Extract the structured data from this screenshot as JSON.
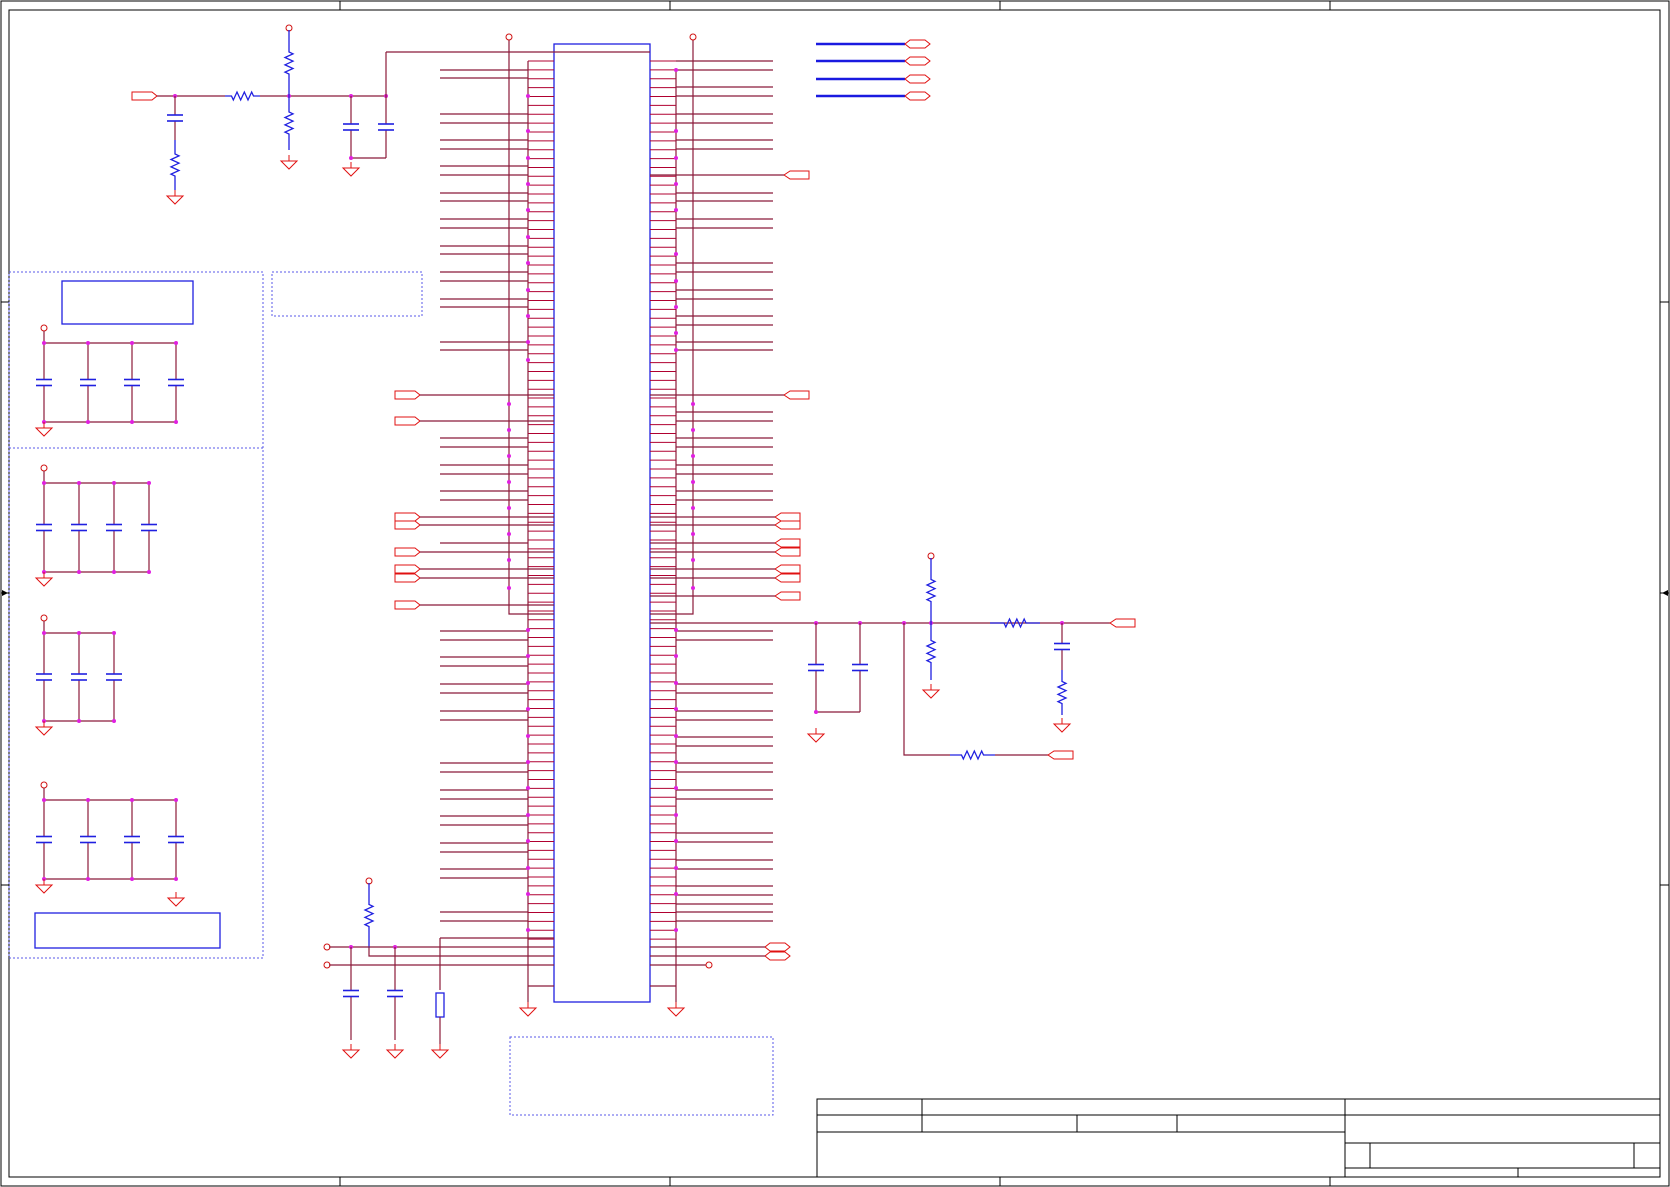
{
  "sheet": {
    "title": "",
    "colors": {
      "wire": "#8b1a3a",
      "component": "#2020e0",
      "ground": "#e01010",
      "junction": "#e020e0",
      "frame": "#000000",
      "annotation_box": "#5a5ae8"
    }
  },
  "symbols": {
    "resistor": "resistor-zigzag",
    "capacitor": "capacitor-plates",
    "ground": "ground-triangle",
    "power": "power-rail-circle",
    "port": "hierarchical-port-pentagon",
    "connector": "connector-rectangle"
  },
  "title_block": {
    "fields": []
  }
}
